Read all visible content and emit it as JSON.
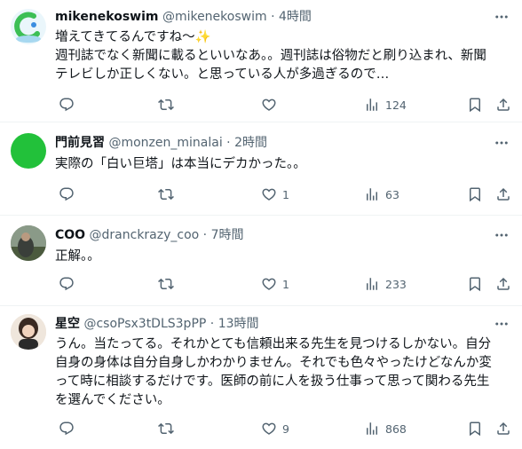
{
  "tweets": [
    {
      "display_name": "mikenekoswim",
      "handle": "@mikenekoswim",
      "time": "4時間",
      "text_lines": [
        "増えてきてるんですね〜✨",
        "週刊誌でなく新聞に載るといいなあ。。週刊誌は俗物だと刷り込まれ、新聞",
        "テレビしか正しくない。と思っている人が多過ぎるので…"
      ],
      "replies": "",
      "retweets": "",
      "likes": "",
      "views": "124",
      "avatar_color": "#a7d8f0"
    },
    {
      "display_name": "門前見習",
      "handle": "@monzen_minalai",
      "time": "2時間",
      "text_lines": [
        "実際の「白い巨塔」は本当にデカかった。。"
      ],
      "replies": "",
      "retweets": "",
      "likes": "1",
      "views": "63",
      "avatar_color": "#22c13a"
    },
    {
      "display_name": "COO",
      "handle": "@dranckrazy_coo",
      "time": "7時間",
      "text_lines": [
        "正解。。"
      ],
      "replies": "",
      "retweets": "",
      "likes": "1",
      "views": "233",
      "avatar_color": "#6f7a63"
    },
    {
      "display_name": "星空",
      "handle": "@csoPsx3tDLS3pPP",
      "time": "13時間",
      "text_lines": [
        "うん。当たってる。それかとても信頼出来る先生を見つけるしかない。自分",
        "自身の身体は自分自身しかわかりません。それでも色々やったけどなんか変",
        "って時に相談するだけです。医師の前に人を扱う仕事って思って関わる先生",
        "を選んでください。"
      ],
      "replies": "",
      "retweets": "",
      "likes": "9",
      "views": "868",
      "avatar_color": "#e6d9cf"
    }
  ],
  "sep": " · "
}
